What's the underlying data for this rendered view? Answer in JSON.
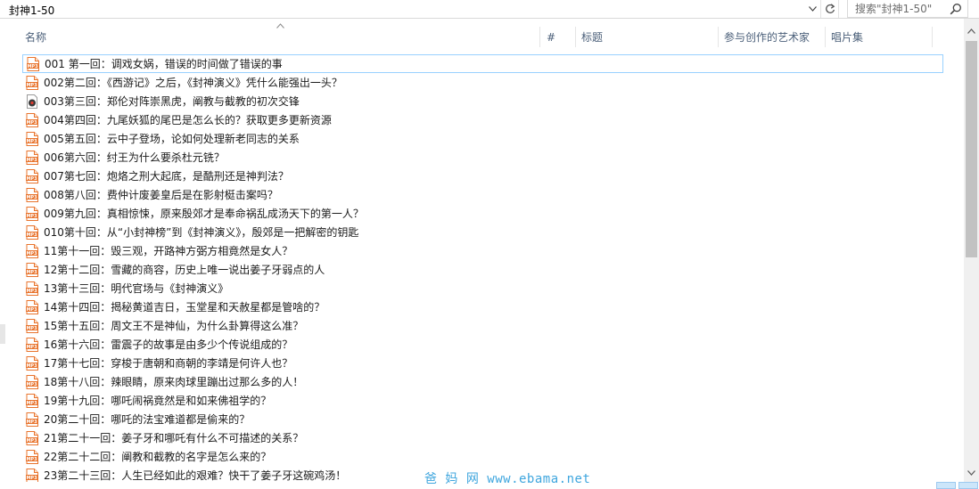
{
  "address": {
    "path": "封神1-50"
  },
  "search": {
    "placeholder": "搜索\"封神1-50\""
  },
  "columns": [
    {
      "label": "名称"
    },
    {
      "label": "#"
    },
    {
      "label": "标题"
    },
    {
      "label": "参与创作的艺术家"
    },
    {
      "label": "唱片集"
    }
  ],
  "files": [
    {
      "name": "001 第一回：调戏女娲，错误的时间做了错误的事",
      "icon": "mp3-icon"
    },
    {
      "name": "002第二回：《西游记》之后，《封神演义》凭什么能强出一头？",
      "icon": "mp3-icon"
    },
    {
      "name": "003第三回：郑伦对阵崇黑虎，阐教与截教的初次交锋",
      "icon": "media-file-icon"
    },
    {
      "name": "004第四回：九尾妖狐的尾巴是怎么长的？获取更多更新资源",
      "icon": "mp3-icon"
    },
    {
      "name": "005第五回：云中子登场，论如何处理新老同志的关系",
      "icon": "mp3-icon"
    },
    {
      "name": "006第六回：纣王为什么要杀杜元铣？",
      "icon": "mp3-icon"
    },
    {
      "name": "007第七回：炮烙之刑大起底，是酷刑还是神判法？",
      "icon": "mp3-icon"
    },
    {
      "name": "008第八回：费仲计废姜皇后是在影射梃击案吗？",
      "icon": "mp3-icon"
    },
    {
      "name": "009第九回：真相惊悚，原来殷郊才是奉命祸乱成汤天下的第一人？",
      "icon": "mp3-icon"
    },
    {
      "name": "010第十回：从“小封神榜”到《封神演义》，殷郊是一把解密的钥匙",
      "icon": "mp3-icon"
    },
    {
      "name": "11第十一回：毁三观，开路神方弼方相竟然是女人？",
      "icon": "mp3-icon"
    },
    {
      "name": "12第十二回：雪藏的商容，历史上唯一说出姜子牙弱点的人",
      "icon": "mp3-icon"
    },
    {
      "name": "13第十三回：明代官场与《封神演义》",
      "icon": "mp3-icon"
    },
    {
      "name": "14第十四回：揭秘黄道吉日，玉堂星和天赦星都是管啥的？",
      "icon": "mp3-icon"
    },
    {
      "name": "15第十五回：周文王不是神仙，为什么卦算得这么准？",
      "icon": "mp3-icon"
    },
    {
      "name": "16第十六回：雷震子的故事是由多少个传说组成的？",
      "icon": "mp3-icon"
    },
    {
      "name": "17第十七回：穿梭于唐朝和商朝的李靖是何许人也？",
      "icon": "mp3-icon"
    },
    {
      "name": "18第十八回：辣眼睛，原来肉球里蹦出过那么多的人！",
      "icon": "mp3-icon"
    },
    {
      "name": "19第十九回：哪吒闹祸竟然是和如来佛祖学的？",
      "icon": "mp3-icon"
    },
    {
      "name": "20第二十回：哪吒的法宝难道都是偷来的？",
      "icon": "mp3-icon"
    },
    {
      "name": "21第二十一回：姜子牙和哪吒有什么不可描述的关系？",
      "icon": "mp3-icon"
    },
    {
      "name": "22第二十二回：阐教和截教的名字是怎么来的？",
      "icon": "mp3-icon"
    },
    {
      "name": "23第二十三回：人生已经如此的艰难？快干了姜子牙这碗鸡汤！",
      "icon": "mp3-icon"
    }
  ],
  "icons": {
    "mp3_label": "MP3"
  },
  "watermark": "爸 妈 网  www.ebama.net",
  "colors": {
    "header_text": "#4c607a",
    "focus_border": "#99d1ff",
    "mp3_icon": "#e8742e",
    "watermark": "#3fa6de"
  }
}
